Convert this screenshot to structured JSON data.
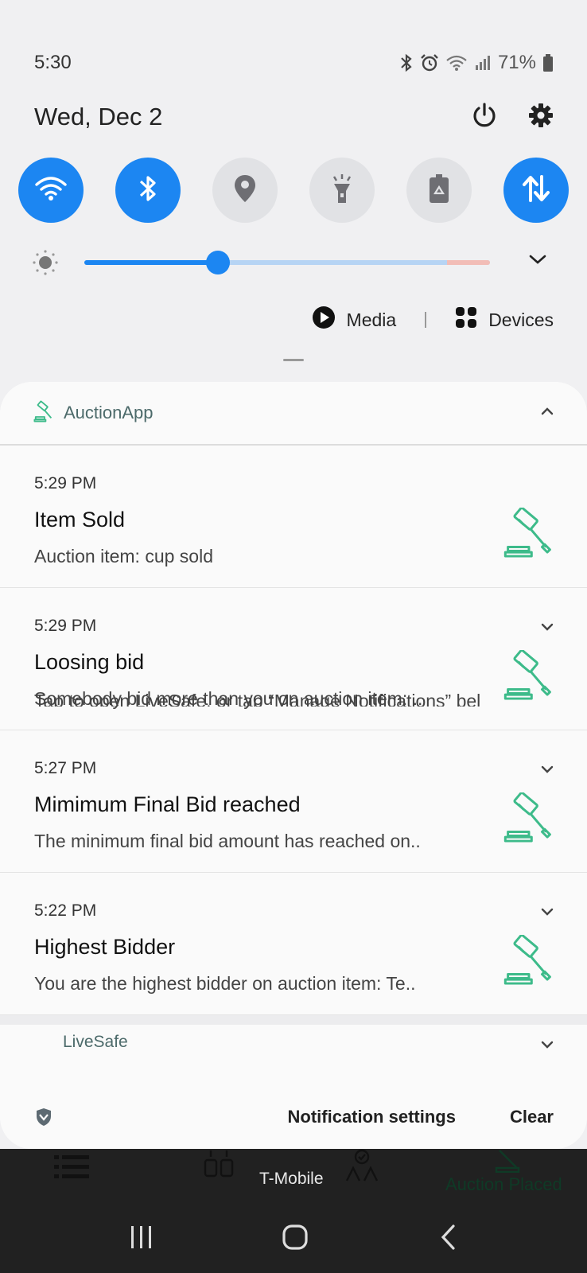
{
  "status_bar": {
    "time": "5:30",
    "battery": "71%",
    "icons": [
      "bluetooth-icon",
      "alarm-icon",
      "wifi-icon",
      "signal-icon",
      "battery-icon"
    ]
  },
  "header": {
    "date": "Wed, Dec 2",
    "icons": [
      "power-icon",
      "gear-icon"
    ]
  },
  "quick_toggles": [
    {
      "name": "wifi",
      "on": true
    },
    {
      "name": "bluetooth",
      "on": true
    },
    {
      "name": "location",
      "on": false
    },
    {
      "name": "flashlight",
      "on": false
    },
    {
      "name": "power-saving",
      "on": false
    },
    {
      "name": "mobile-data",
      "on": true
    }
  ],
  "brightness": {
    "level": 0.33
  },
  "media_row": {
    "media_label": "Media",
    "devices_label": "Devices"
  },
  "notifications": {
    "app_name": "AuctionApp",
    "items": [
      {
        "time": "5:29 PM",
        "title": "Item Sold",
        "body": "Auction item: cup sold"
      },
      {
        "time": "5:29 PM",
        "title": "Loosing bid",
        "body": "Somebody bid more than you on auction item: .."
      },
      {
        "time": "5:27 PM",
        "title": "Mimimum Final Bid reached",
        "body": "The minimum final bid amount has reached on.."
      },
      {
        "time": "5:22 PM",
        "title": "Highest Bidder",
        "body": "You are the highest bidder on auction item: Te.."
      }
    ],
    "livesafe": {
      "app_name": "LiveSafe",
      "body": "Tap to open LiveSafe, or tap “Manage Notifications” bel"
    },
    "footer": {
      "settings_label": "Notification settings",
      "clear_label": "Clear"
    }
  },
  "background_app": {
    "carrier": "T-Mobile",
    "tab_label": "Auction Placed"
  },
  "colors": {
    "accent": "#1c86f2",
    "gavel": "#3dbb8a",
    "toggle_off": "#e1e2e5"
  }
}
